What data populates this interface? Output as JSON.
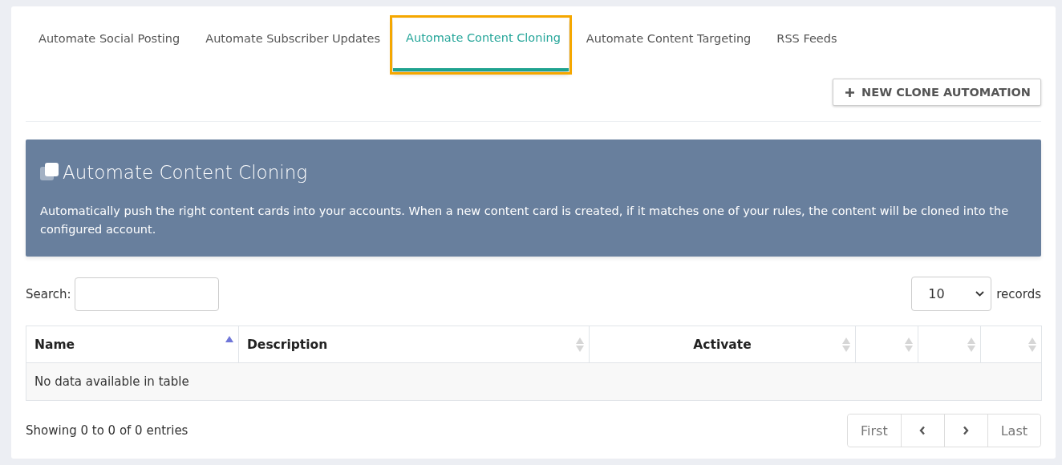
{
  "tabs": [
    {
      "label": "Automate Social Posting",
      "selected": false
    },
    {
      "label": "Automate Subscriber Updates",
      "selected": false
    },
    {
      "label": "Automate Content Cloning",
      "selected": true
    },
    {
      "label": "Automate Content Targeting",
      "selected": false
    },
    {
      "label": "RSS Feeds",
      "selected": false
    }
  ],
  "new_button": {
    "label": "NEW CLONE AUTOMATION"
  },
  "banner": {
    "title": "Automate Content Cloning",
    "text": "Automatically push the right content cards into your accounts. When a new content card is created, if it matches one of your rules, the content will be cloned into the configured account."
  },
  "search": {
    "label": "Search:"
  },
  "page_size": {
    "value": "10",
    "label": "records"
  },
  "table": {
    "columns": [
      {
        "label": "Name",
        "sorted": true
      },
      {
        "label": "Description",
        "sorted": false
      },
      {
        "label": "Activate",
        "sorted": false
      },
      {
        "sorted": false
      },
      {
        "sorted": false
      },
      {
        "sorted": false
      }
    ],
    "empty_message": "No data available in table"
  },
  "footer": {
    "info": "Showing 0 to 0 of 0 entries"
  },
  "pagination": [
    {
      "kind": "text",
      "label": "First"
    },
    {
      "kind": "prev"
    },
    {
      "kind": "next"
    },
    {
      "kind": "text",
      "label": "Last"
    }
  ]
}
